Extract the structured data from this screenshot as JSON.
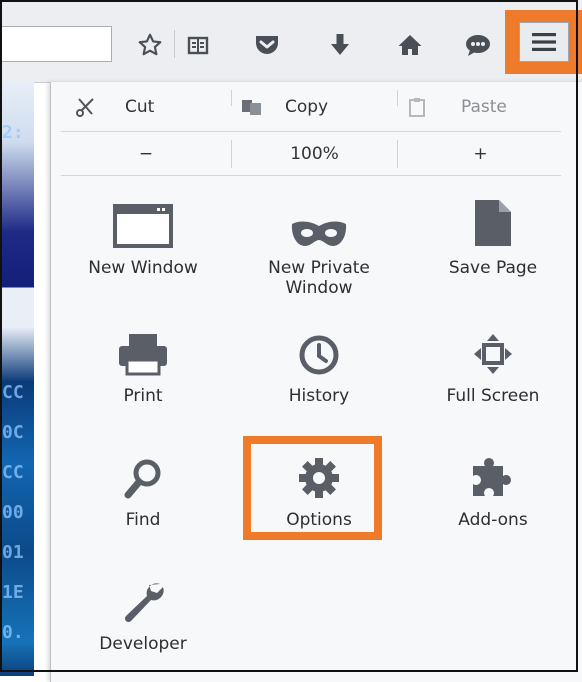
{
  "toolbar": {
    "icons": [
      "star-icon",
      "reader-icon",
      "pocket-icon",
      "download-icon",
      "home-icon",
      "chat-icon",
      "hamburger-menu-icon"
    ],
    "highlight_color": "#ee7b2c"
  },
  "background_code": [
    "2:",
    "CC",
    "0C",
    "CC",
    "00",
    "01",
    "1E",
    "0."
  ],
  "menu": {
    "cut_label": "Cut",
    "copy_label": "Copy",
    "paste_label": "Paste",
    "zoom_out_label": "−",
    "zoom_level": "100%",
    "zoom_in_label": "+",
    "items": [
      {
        "label": "New Window",
        "icon": "window-icon"
      },
      {
        "label": "New Private\nWindow",
        "icon": "private-mask-icon"
      },
      {
        "label": "Save Page",
        "icon": "page-icon"
      },
      {
        "label": "Print",
        "icon": "printer-icon"
      },
      {
        "label": "History",
        "icon": "clock-icon"
      },
      {
        "label": "Full Screen",
        "icon": "fullscreen-icon"
      },
      {
        "label": "Find",
        "icon": "magnifier-icon"
      },
      {
        "label": "Options",
        "icon": "gear-icon",
        "highlighted": true
      },
      {
        "label": "Add-ons",
        "icon": "puzzle-icon"
      },
      {
        "label": "Developer",
        "icon": "wrench-icon"
      }
    ]
  }
}
